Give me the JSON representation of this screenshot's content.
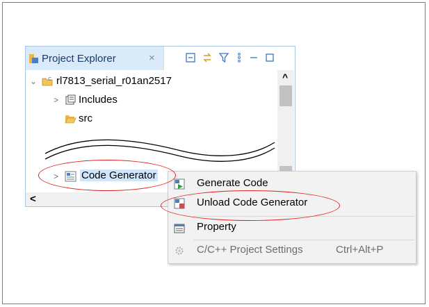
{
  "panel": {
    "tab_title": "Project Explorer",
    "tab_close": "×"
  },
  "tree": {
    "project": "rl7813_serial_r01an2517",
    "includes": "Includes",
    "src": "src",
    "code_generator": "Code Generator"
  },
  "scroll": {
    "up_arrow": "^",
    "left_arrow": "<"
  },
  "context_menu": {
    "items": [
      {
        "label": "Generate Code",
        "enabled": true
      },
      {
        "label": "Unload Code Generator",
        "enabled": true
      },
      {
        "label": "Property",
        "enabled": true
      },
      {
        "label": "C/C++ Project Settings",
        "shortcut": "Ctrl+Alt+P",
        "enabled": false
      }
    ]
  },
  "colors": {
    "highlight": "#e02020",
    "tab_bg": "#dbeaf8"
  }
}
